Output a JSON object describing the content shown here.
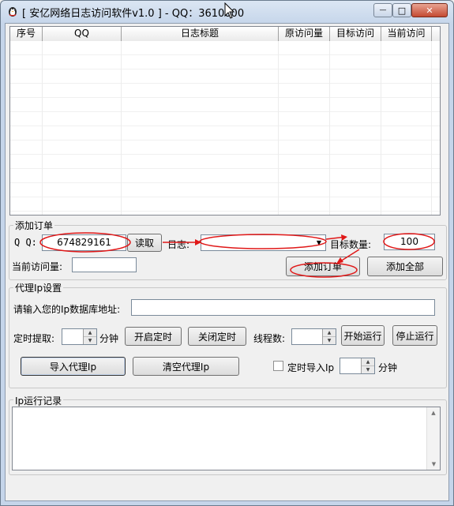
{
  "window": {
    "title": "[ 安亿网络日志访问软件v1.0 ] - QQ：3610000",
    "minimize_glyph": "—",
    "maximize_glyph": "□",
    "close_glyph": "✕"
  },
  "grid": {
    "columns": [
      "序号",
      "QQ",
      "日志标题",
      "原访问量",
      "目标访问",
      "当前访问"
    ],
    "rows": []
  },
  "add_order": {
    "group_title": "添加订单",
    "qq_label": "Q Q:",
    "qq_value": "674829161",
    "read_button": "读取",
    "log_label": "日志:",
    "log_selected": "",
    "target_label": "目标数量:",
    "target_value": "100",
    "current_label": "当前访问量:",
    "current_value": "",
    "add_order_button": "添加订单",
    "add_all_button": "添加全部"
  },
  "proxy": {
    "group_title": "代理Ip设置",
    "db_label": "请输入您的Ip数据库地址:",
    "db_value": "",
    "timer_label": "定时提取:",
    "timer_value": "",
    "minute_unit": "分钟",
    "start_timer_button": "开启定时",
    "stop_timer_button": "关闭定时",
    "threads_label": "线程数:",
    "threads_value": "",
    "start_run_button": "开始运行",
    "stop_run_button": "停止运行",
    "import_proxy_button": "导入代理Ip",
    "clear_proxy_button": "清空代理Ip",
    "timed_import_label": "定时导入Ip",
    "timed_import_checked": false,
    "timed_import_value": "",
    "timed_import_unit": "分钟"
  },
  "log": {
    "group_title": "Ip运行记录",
    "content": ""
  },
  "colors": {
    "annotation_red": "#e01818",
    "window_border": "#6b7b8d"
  }
}
